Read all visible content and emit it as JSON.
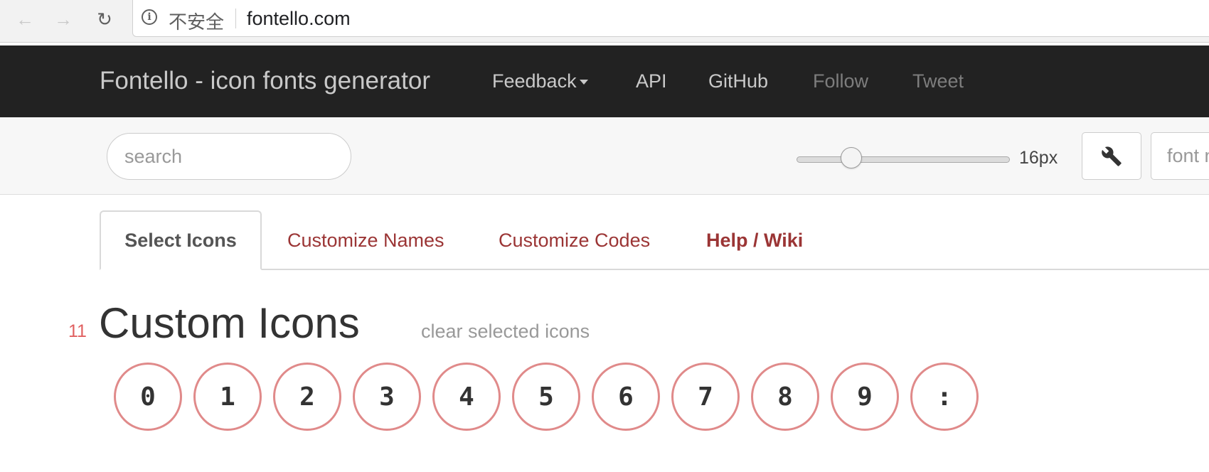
{
  "browser": {
    "security_label": "不安全",
    "url": "fontello.com"
  },
  "navbar": {
    "brand": "Fontello - icon fonts generator",
    "links": [
      {
        "label": "Feedback",
        "has_caret": true
      },
      {
        "label": "API"
      },
      {
        "label": "GitHub"
      },
      {
        "label": "Follow"
      },
      {
        "label": "Tweet"
      }
    ]
  },
  "toolbar": {
    "search_placeholder": "search",
    "size_slider": {
      "value_label": "16px"
    },
    "settings_icon": "wrench-icon",
    "font_name_placeholder": "font name"
  },
  "tabs": [
    {
      "label": "Select Icons",
      "active": true
    },
    {
      "label": "Customize Names"
    },
    {
      "label": "Customize Codes"
    },
    {
      "label": "Help / Wiki"
    }
  ],
  "section": {
    "count": "11",
    "title": "Custom Icons",
    "clear_label": "clear selected icons",
    "glyphs": [
      "0",
      "1",
      "2",
      "3",
      "4",
      "5",
      "6",
      "7",
      "8",
      "9",
      ":"
    ]
  },
  "colors": {
    "navbar_bg": "#222222",
    "tab_link": "#9b3535",
    "glyph_border": "#e08a8a",
    "count": "#e06060"
  }
}
